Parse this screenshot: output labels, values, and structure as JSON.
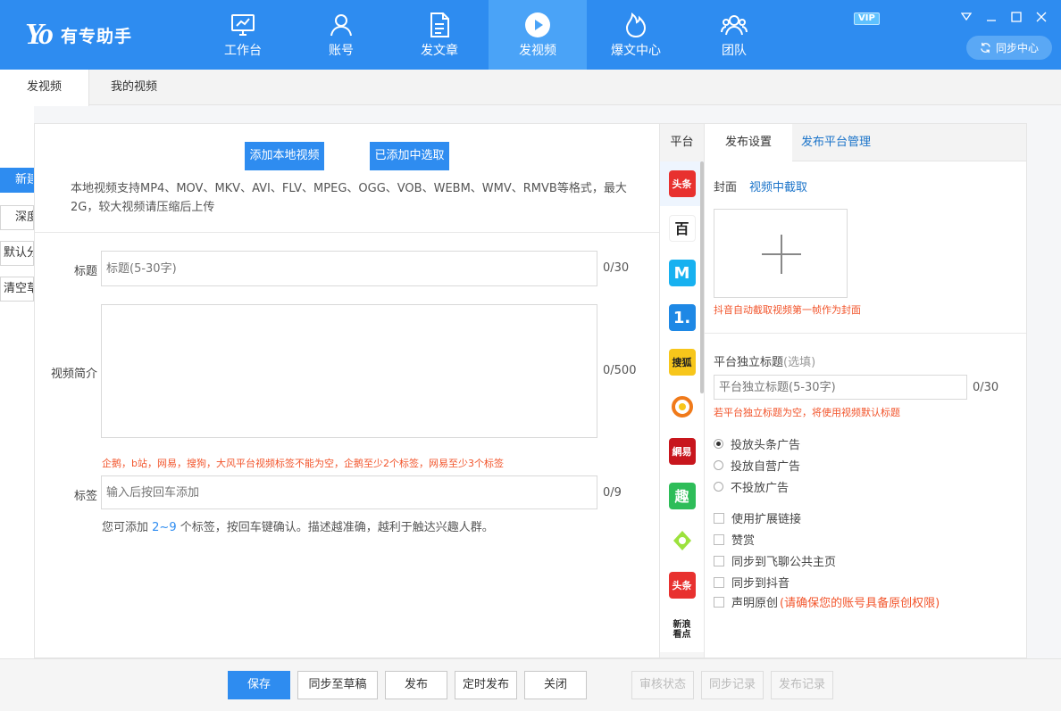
{
  "app": {
    "logo_mark": "Yo",
    "logo_text": "有专助手",
    "vip": "VIP",
    "sync_center": "同步中心"
  },
  "nav": [
    {
      "label": "工作台",
      "icon": "monitor-icon"
    },
    {
      "label": "账号",
      "icon": "user-icon"
    },
    {
      "label": "发文章",
      "icon": "document-icon"
    },
    {
      "label": "发视频",
      "icon": "play-icon",
      "active": true
    },
    {
      "label": "爆文中心",
      "icon": "flame-icon"
    },
    {
      "label": "团队",
      "icon": "team-icon"
    }
  ],
  "tabs": {
    "publish_video": "发视频",
    "my_videos": "我的视频"
  },
  "left_edge": {
    "new_btn": "新建",
    "deep_btn": "深度",
    "default_btn": "默认分",
    "clear_btn": "清空草"
  },
  "upload": {
    "add_local": "添加本地视频",
    "select_added": "已添加中选取",
    "note": "本地视频支持MP4、MOV、MKV、AVI、FLV、MPEG、OGG、VOB、WEBM、WMV、RMVB等格式，最大2G，较大视频请压缩后上传"
  },
  "form": {
    "title_label": "标题",
    "title_placeholder": "标题(5-30字)",
    "title_count": "0/30",
    "intro_label": "视频简介",
    "intro_count": "0/500",
    "tag_warning": "企鹅，b站，网易，搜狗，大风平台视频标签不能为空，企鹅至少2个标签，网易至少3个标签",
    "tag_label": "标签",
    "tag_placeholder": "输入后按回车添加",
    "tag_count": "0/9",
    "tag_hint_pre": "您可添加",
    "tag_hint_range": "2~9",
    "tag_hint_post": "个标签，按回车键确认。描述越准确，越利于触达兴趣人群。"
  },
  "platforms": {
    "header": "平台",
    "items": [
      {
        "name": "toutiao-icon",
        "text": "头条",
        "color": "#e8312f"
      },
      {
        "name": "baijiahao-icon",
        "text": "百",
        "color": "#ffffff"
      },
      {
        "name": "meipai-icon",
        "text": "M",
        "color": "#17b1f0"
      },
      {
        "name": "yidian-icon",
        "text": "1.",
        "color": "#1e88e5"
      },
      {
        "name": "sohu-icon",
        "text": "搜狐",
        "color": "#f7c61b"
      },
      {
        "name": "dayu-icon",
        "text": "",
        "color": "#ffffff"
      },
      {
        "name": "netease-icon",
        "text": "網易",
        "color": "#c8161d"
      },
      {
        "name": "qutoutiao-icon",
        "text": "趣",
        "color": "#2ebd59"
      },
      {
        "name": "iqiyi-icon",
        "text": "",
        "color": "#ffffff"
      },
      {
        "name": "toutiao2-icon",
        "text": "头条",
        "color": "#e8312f"
      },
      {
        "name": "sina-icon",
        "text": "新浪看点",
        "color": "#ffffff"
      }
    ]
  },
  "settings": {
    "tab_publish": "发布设置",
    "tab_manage": "发布平台管理",
    "cover_label": "封面",
    "cover_link": "视频中截取",
    "cover_note": "抖音自动截取视频第一帧作为封面",
    "own_title_label": "平台独立标题",
    "own_title_optional": "(选填)",
    "own_title_placeholder": "平台独立标题(5-30字)",
    "own_title_count": "0/30",
    "own_title_note": "若平台独立标题为空，将使用视频默认标题",
    "radios": [
      {
        "label": "投放头条广告",
        "checked": true
      },
      {
        "label": "投放自营广告",
        "checked": false
      },
      {
        "label": "不投放广告",
        "checked": false
      }
    ],
    "checks": [
      {
        "label": "使用扩展链接"
      },
      {
        "label": "赞赏"
      },
      {
        "label": "同步到飞聊公共主页"
      },
      {
        "label": "同步到抖音"
      },
      {
        "label": "声明原创",
        "extra": "(请确保您的账号具备原创权限)"
      }
    ]
  },
  "bottom": {
    "save": "保存",
    "sync_draft": "同步至草稿",
    "publish": "发布",
    "timed_publish": "定时发布",
    "close": "关闭",
    "review_status": "审核状态",
    "sync_records": "同步记录",
    "publish_records": "发布记录"
  },
  "colors": {
    "brand": "#2e8cf0",
    "warning": "#f2552c",
    "link": "#1a73c9"
  }
}
